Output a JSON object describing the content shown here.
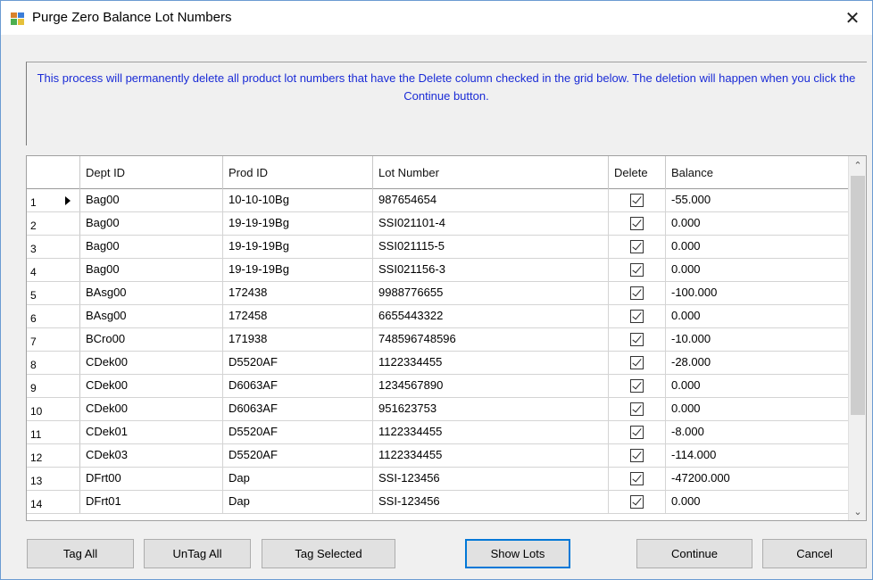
{
  "window": {
    "title": "Purge Zero Balance Lot Numbers",
    "close_glyph": "✕"
  },
  "message": "This process will permanently delete all product lot numbers that have the Delete column checked in the grid below. The deletion will happen when you click the Continue button.",
  "grid": {
    "columns": [
      "",
      "Dept ID",
      "Prod ID",
      "Lot Number",
      "Delete",
      "Balance"
    ],
    "rows": [
      {
        "num": "1",
        "dept": "Bag00",
        "prod": "10-10-10Bg",
        "lot": "987654654",
        "delete": true,
        "balance": "-55.000",
        "current": true
      },
      {
        "num": "2",
        "dept": "Bag00",
        "prod": "19-19-19Bg",
        "lot": "SSI021101-4",
        "delete": true,
        "balance": "0.000"
      },
      {
        "num": "3",
        "dept": "Bag00",
        "prod": "19-19-19Bg",
        "lot": "SSI021115-5",
        "delete": true,
        "balance": "0.000"
      },
      {
        "num": "4",
        "dept": "Bag00",
        "prod": "19-19-19Bg",
        "lot": "SSI021156-3",
        "delete": true,
        "balance": "0.000"
      },
      {
        "num": "5",
        "dept": "BAsg00",
        "prod": "172438",
        "lot": "9988776655",
        "delete": true,
        "balance": "-100.000"
      },
      {
        "num": "6",
        "dept": "BAsg00",
        "prod": "172458",
        "lot": "6655443322",
        "delete": true,
        "balance": "0.000"
      },
      {
        "num": "7",
        "dept": "BCro00",
        "prod": "171938",
        "lot": "748596748596",
        "delete": true,
        "balance": "-10.000"
      },
      {
        "num": "8",
        "dept": "CDek00",
        "prod": "D5520AF",
        "lot": "1122334455",
        "delete": true,
        "balance": "-28.000"
      },
      {
        "num": "9",
        "dept": "CDek00",
        "prod": "D6063AF",
        "lot": "1234567890",
        "delete": true,
        "balance": "0.000"
      },
      {
        "num": "10",
        "dept": "CDek00",
        "prod": "D6063AF",
        "lot": "951623753",
        "delete": true,
        "balance": "0.000"
      },
      {
        "num": "11",
        "dept": "CDek01",
        "prod": "D5520AF",
        "lot": "1122334455",
        "delete": true,
        "balance": "-8.000"
      },
      {
        "num": "12",
        "dept": "CDek03",
        "prod": "D5520AF",
        "lot": "1122334455",
        "delete": true,
        "balance": "-114.000"
      },
      {
        "num": "13",
        "dept": "DFrt00",
        "prod": "Dap",
        "lot": "SSI-123456",
        "delete": true,
        "balance": "-47200.000"
      },
      {
        "num": "14",
        "dept": "DFrt01",
        "prod": "Dap",
        "lot": "SSI-123456",
        "delete": true,
        "balance": "0.000"
      }
    ]
  },
  "scrollbar": {
    "up": "⌃",
    "down": "⌄"
  },
  "buttons": {
    "tag_all": "Tag All",
    "untag_all": "UnTag All",
    "tag_selected": "Tag Selected",
    "show_lots": "Show Lots",
    "continue": "Continue",
    "cancel": "Cancel"
  }
}
